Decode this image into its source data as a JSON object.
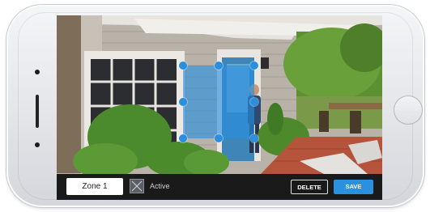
{
  "zone_editor": {
    "zone_name_value": "Zone 1",
    "active_label": "Active",
    "active_checked": false,
    "delete_label": "DELETE",
    "save_label": "SAVE"
  },
  "colors": {
    "accent": "#2a90e0",
    "zone_fill": "#268ee0",
    "toolbar_background": "#1a1a1a"
  },
  "icons": {
    "checkbox": "x-mark-icon",
    "zone_handles": "circle-handle-icon"
  }
}
